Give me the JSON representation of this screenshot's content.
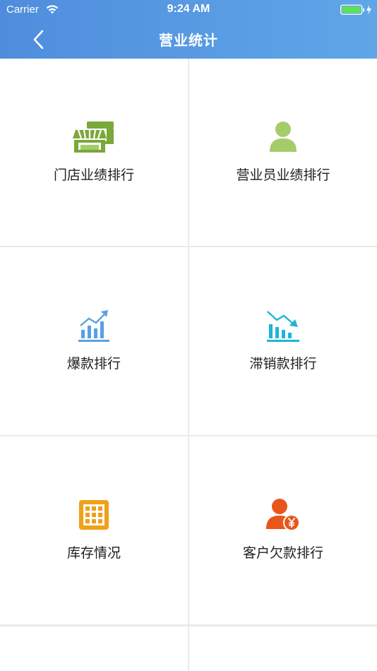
{
  "status_bar": {
    "carrier": "Carrier",
    "time": "9:24 AM"
  },
  "nav": {
    "title": "营业统计",
    "back_icon": "chevron-left-icon"
  },
  "colors": {
    "header_start": "#4f8ddc",
    "header_end": "#5fa6e8",
    "green": "#7aa83a",
    "light_green": "#a5cc6b",
    "blue": "#5aa0e2",
    "cyan": "#1fb4d4",
    "orange": "#f0a019",
    "red_orange": "#e8561c"
  },
  "menu": [
    {
      "label": "门店业绩排行",
      "icon": "store-icon"
    },
    {
      "label": "营业员业绩排行",
      "icon": "person-icon"
    },
    {
      "label": "爆款排行",
      "icon": "chart-up-icon"
    },
    {
      "label": "滞销款排行",
      "icon": "chart-down-icon"
    },
    {
      "label": "库存情况",
      "icon": "inventory-grid-icon"
    },
    {
      "label": "客户欠款排行",
      "icon": "customer-debt-icon"
    }
  ]
}
